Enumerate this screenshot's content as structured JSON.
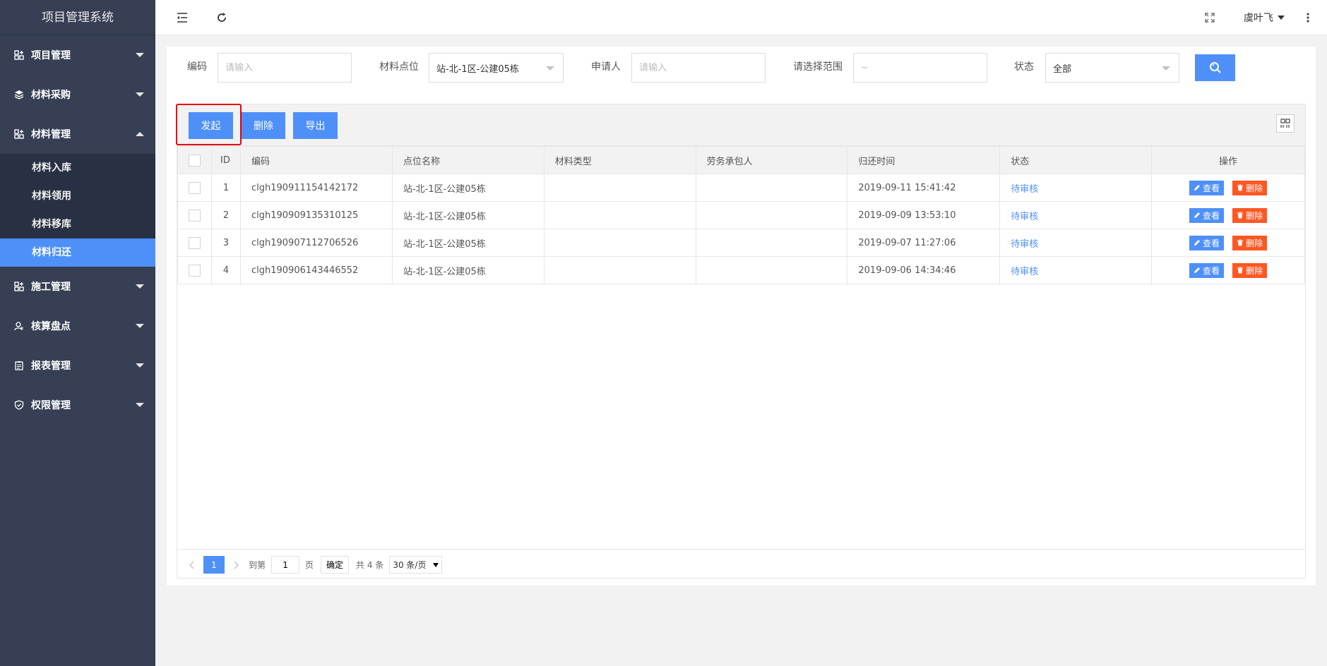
{
  "app_title": "项目管理系统",
  "sidebar": {
    "items": [
      {
        "label": "项目管理",
        "icon": "grid-plus-icon",
        "expanded": false
      },
      {
        "label": "材料采购",
        "icon": "layers-icon",
        "expanded": false
      },
      {
        "label": "材料管理",
        "icon": "grid-plus-icon",
        "expanded": true,
        "children": [
          {
            "label": "材料入库"
          },
          {
            "label": "材料领用"
          },
          {
            "label": "材料移库"
          },
          {
            "label": "材料归还",
            "active": true
          }
        ]
      },
      {
        "label": "施工管理",
        "icon": "grid-plus-icon",
        "expanded": false
      },
      {
        "label": "核算盘点",
        "icon": "user-icon",
        "expanded": false
      },
      {
        "label": "报表管理",
        "icon": "clipboard-icon",
        "expanded": false
      },
      {
        "label": "权限管理",
        "icon": "shield-check-icon",
        "expanded": false
      }
    ]
  },
  "header": {
    "user_name": "虞叶飞"
  },
  "filters": {
    "code_label": "编码",
    "code_placeholder": "请输入",
    "location_label": "材料点位",
    "location_value": "站-北-1区-公建05栋",
    "applicant_label": "申请人",
    "applicant_placeholder": "请输入",
    "range_label": "请选择范围",
    "range_value": "~",
    "status_label": "状态",
    "status_value": "全部"
  },
  "toolbar": {
    "launch_label": "发起",
    "delete_label": "删除",
    "export_label": "导出"
  },
  "table": {
    "columns": [
      "ID",
      "编码",
      "点位名称",
      "材料类型",
      "劳务承包人",
      "归还时间",
      "状态",
      "操作"
    ],
    "view_label": "查看",
    "delete_label": "删除",
    "rows": [
      {
        "id": "1",
        "code": "clgh190911154142172",
        "location": "站-北-1区-公建05栋",
        "type": "",
        "contractor": "",
        "time": "2019-09-11 15:41:42",
        "status": "待审核"
      },
      {
        "id": "2",
        "code": "clgh190909135310125",
        "location": "站-北-1区-公建05栋",
        "type": "",
        "contractor": "",
        "time": "2019-09-09 13:53:10",
        "status": "待审核"
      },
      {
        "id": "3",
        "code": "clgh190907112706526",
        "location": "站-北-1区-公建05栋",
        "type": "",
        "contractor": "",
        "time": "2019-09-07 11:27:06",
        "status": "待审核"
      },
      {
        "id": "4",
        "code": "clgh190906143446552",
        "location": "站-北-1区-公建05栋",
        "type": "",
        "contractor": "",
        "time": "2019-09-06 14:34:46",
        "status": "待审核"
      }
    ]
  },
  "pager": {
    "current_page": "1",
    "goto_label": "到第",
    "goto_value": "1",
    "page_unit": "页",
    "confirm_label": "确定",
    "total_label": "共 4 条",
    "page_size": "30 条/页"
  },
  "colors": {
    "sidebar_bg": "#363f54",
    "sub_bg": "#283044",
    "accent": "#4e90f8",
    "danger": "#ff5722",
    "highlight": "#e60012"
  }
}
